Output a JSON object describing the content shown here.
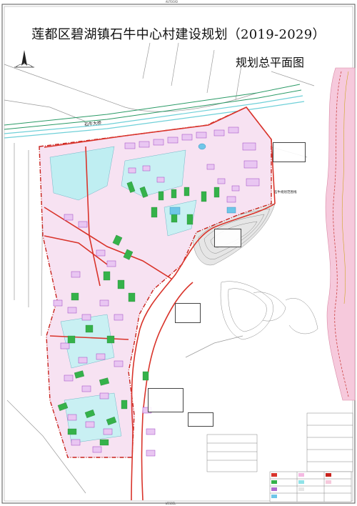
{
  "title": "莲都区碧湖镇石牛中心村建设规划（2019-2029）",
  "subtitle": "规划总平面图",
  "map_labels": {
    "bridge": "石牛大桥",
    "road_elevation": "石牛大桥",
    "reservoir": "石牛规划范围线"
  },
  "frame_coords": {
    "top": "AUTOCAD",
    "bottom": "WISOIL"
  },
  "colors": {
    "road_red": "#d9342b",
    "boundary_red": "#c8231d",
    "green_space": "#35b24a",
    "building_purple": "#b06ad0",
    "water_cyan": "#8fe3e8",
    "field_pink": "#f4b9e2",
    "river_pink": "#f6c9dc",
    "hill_gray": "#8a8a8a"
  }
}
